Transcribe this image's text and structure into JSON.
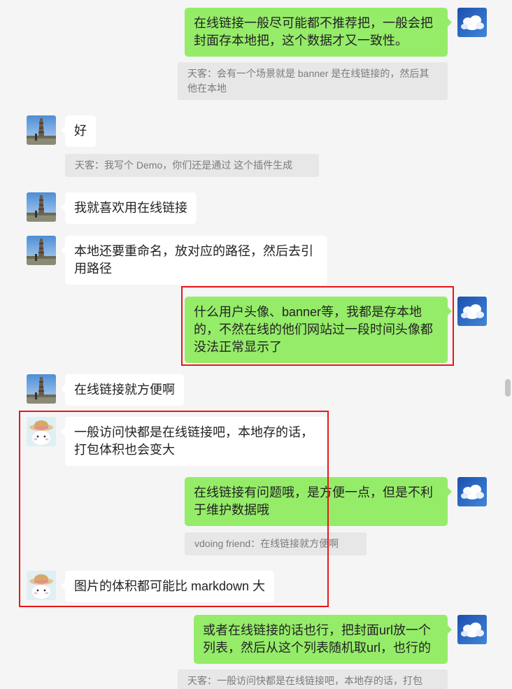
{
  "colors": {
    "background": "#f5f5f5",
    "bubble_self": "#95ec69",
    "bubble_other": "#ffffff",
    "quote_bg": "#e7e7e7",
    "highlight": "#e8161a"
  },
  "avatars": {
    "self": "sky-clouds-avatar",
    "tower_user": "tower-landscape-avatar",
    "hat_user": "cartoon-hat-avatar"
  },
  "messages": [
    {
      "text": "在线链接一般尽可能都不推荐把，一般会把封面存本地把，这个数据才又一致性。"
    },
    {
      "text": "天客：会有一个场景就是 banner 是在线链接的，然后其他在本地"
    },
    {
      "text": "好"
    },
    {
      "text": "天客：我写个 Demo，你们还是通过 这个插件生成"
    },
    {
      "text": "我就喜欢用在线链接"
    },
    {
      "text": "本地还要重命名，放对应的路径，然后去引用路径"
    },
    {
      "text": "什么用户头像、banner等，我都是存本地的，不然在线的他们网站过一段时间头像都没法正常显示了"
    },
    {
      "text": "在线链接就方便啊"
    },
    {
      "text": "一般访问快都是在线链接吧，本地存的话，打包体积也会变大"
    },
    {
      "text": "在线链接有问题哦，是方便一点，但是不利于维护数据哦"
    },
    {
      "text": "vdoing friend：在线链接就方便啊"
    },
    {
      "text": "图片的体积都可能比 markdown 大"
    },
    {
      "text": "或者在线链接的话也行，把封面url放一个列表，然后从这个列表随机取url，也行的"
    },
    {
      "text": "天客：一般访问快都是在线链接吧，本地存的话，打包"
    }
  ]
}
